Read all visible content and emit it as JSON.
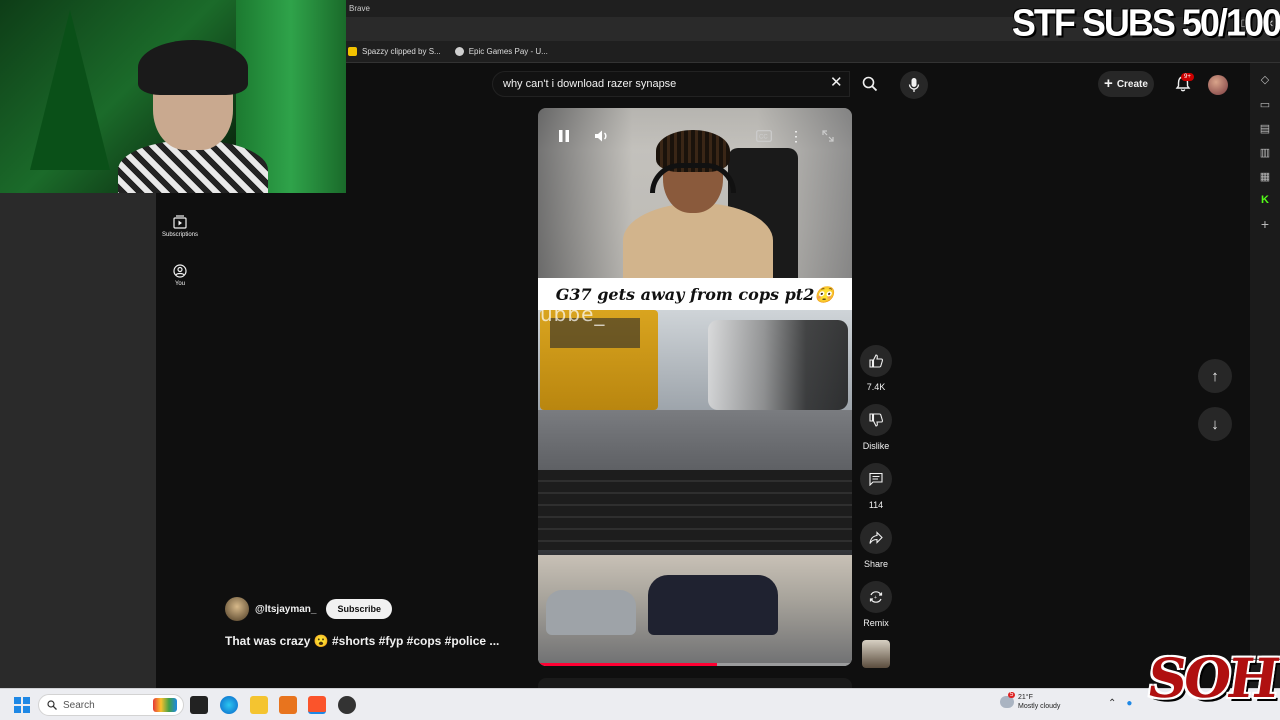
{
  "overlay": {
    "stream_title": "STF SUBS 50/100",
    "logo_text": "SOH"
  },
  "browser": {
    "title": "Brave",
    "bookmarks": [
      {
        "label": "Spazzy clipped by S...",
        "color": "#f2c200"
      },
      {
        "label": "Epic Games Pay - U...",
        "color": "#cfcfcf"
      }
    ]
  },
  "youtube": {
    "search": {
      "value": "why can't i download razer synapse"
    },
    "create_label": "Create",
    "notifications_badge": "9+",
    "guide": [
      {
        "label": "Subscriptions",
        "icon": "subscriptions-icon"
      },
      {
        "label": "You",
        "icon": "you-icon"
      }
    ],
    "short": {
      "caption": "G37 gets away from cops pt2😳",
      "watermark": "ubbe_",
      "channel": "@ltsjayman_",
      "subscribe_label": "Subscribe",
      "title": "That was crazy 😮 #shorts #fyp #cops #police ...",
      "progress": 0.57
    },
    "actions": {
      "like_count": "7.4K",
      "dislike_label": "Dislike",
      "comment_count": "114",
      "share_label": "Share",
      "remix_label": "Remix"
    }
  },
  "taskbar": {
    "search_placeholder": "Search",
    "weather_temp": "21°F",
    "weather_desc": "Mostly cloudy",
    "weather_badge": "5"
  }
}
